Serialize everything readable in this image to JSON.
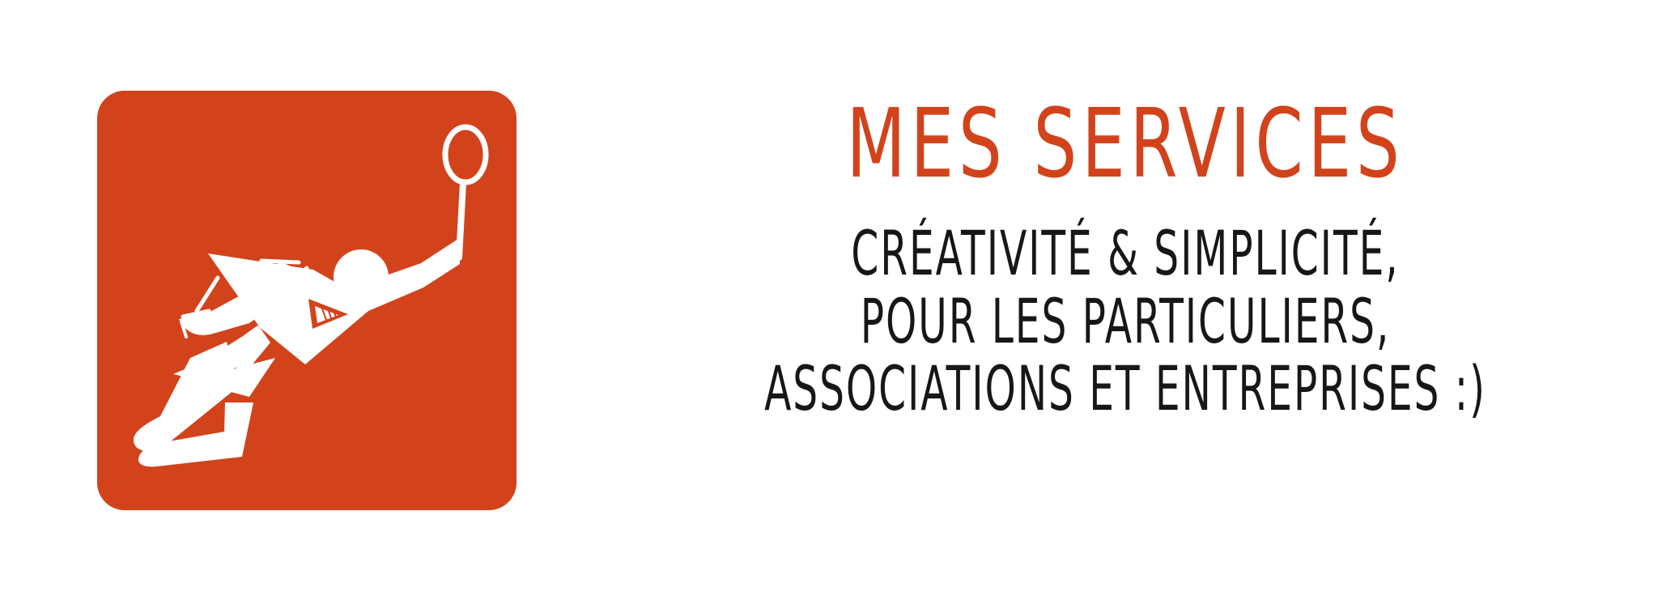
{
  "brand": {
    "background_color": "#d2431c",
    "text_color": "#171717",
    "accent_color": "#d2431c"
  },
  "logo": {
    "icon_name": "badminton-player-icon"
  },
  "title": "MES SERVICES",
  "subtitle_lines": [
    "CRÉATIVITÉ & SIMPLICITÉ,",
    "POUR LES PARTICULIERS,",
    "ASSOCIATIONS ET ENTREPRISES :)"
  ]
}
